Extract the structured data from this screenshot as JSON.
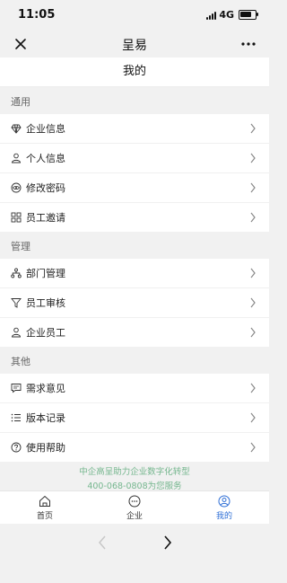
{
  "status": {
    "time": "11:05",
    "network": "4G"
  },
  "nav": {
    "title": "呈易"
  },
  "page": {
    "title": "我的"
  },
  "sections": [
    {
      "label": "通用",
      "items": [
        {
          "label": "企业信息",
          "icon": "diamond-icon"
        },
        {
          "label": "个人信息",
          "icon": "user-icon"
        },
        {
          "label": "修改密码",
          "icon": "eye-icon"
        },
        {
          "label": "员工邀请",
          "icon": "grid-icon"
        }
      ]
    },
    {
      "label": "管理",
      "items": [
        {
          "label": "部门管理",
          "icon": "org-chart-icon"
        },
        {
          "label": "员工审核",
          "icon": "filter-icon"
        },
        {
          "label": "企业员工",
          "icon": "user-icon"
        }
      ]
    },
    {
      "label": "其他",
      "items": [
        {
          "label": "需求意见",
          "icon": "message-icon"
        },
        {
          "label": "版本记录",
          "icon": "list-icon"
        },
        {
          "label": "使用帮助",
          "icon": "help-icon"
        }
      ]
    }
  ],
  "footer": {
    "line1": "中企高呈助力企业数字化转型",
    "line2": "400-068-0808为您服务"
  },
  "tabs": [
    {
      "label": "首页",
      "icon": "home-icon",
      "active": false
    },
    {
      "label": "企业",
      "icon": "chat-dots-icon",
      "active": false
    },
    {
      "label": "我的",
      "icon": "profile-icon",
      "active": true
    }
  ],
  "colors": {
    "accent": "#2f6fd6",
    "footer_text": "#76b78f",
    "background": "#f1f1f1"
  }
}
